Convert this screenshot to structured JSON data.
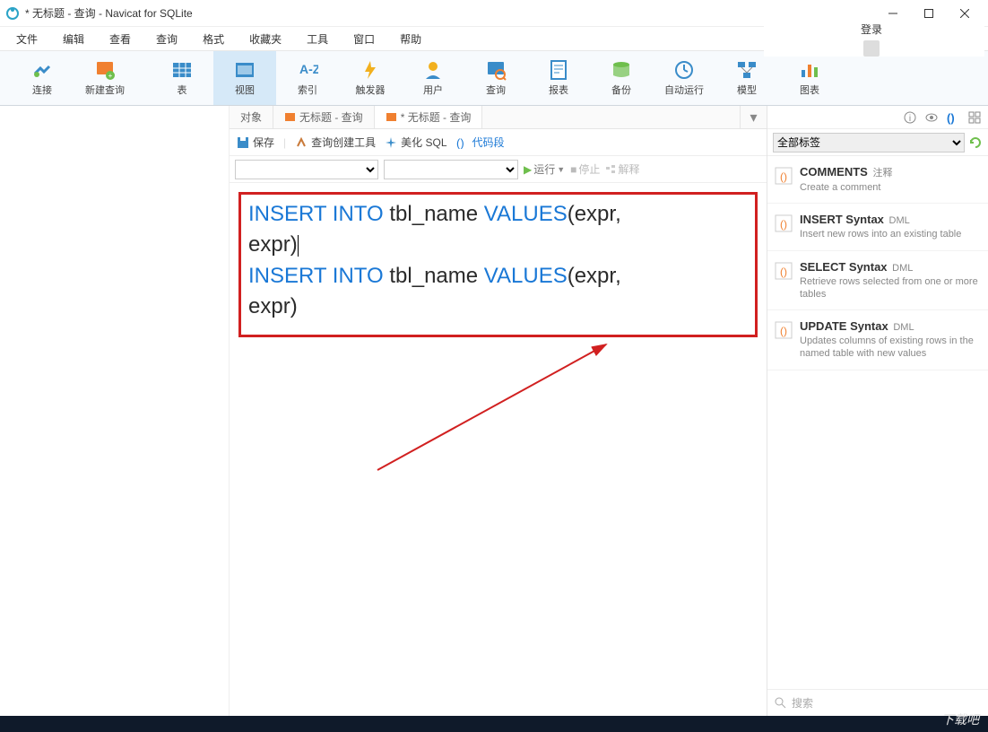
{
  "window": {
    "title": "* 无标题 - 查询 - Navicat for SQLite"
  },
  "menu": {
    "file": "文件",
    "edit": "编辑",
    "view": "查看",
    "query": "查询",
    "format": "格式",
    "favorites": "收藏夹",
    "tools": "工具",
    "window": "窗口",
    "help": "帮助",
    "login": "登录"
  },
  "toolbar": {
    "connect": "连接",
    "newquery": "新建查询",
    "table": "表",
    "view": "视图",
    "index": "索引",
    "trigger": "触发器",
    "user": "用户",
    "query": "查询",
    "report": "报表",
    "backup": "备份",
    "auto": "自动运行",
    "model": "模型",
    "chart": "图表"
  },
  "tabs": {
    "objects": "对象",
    "untitled1": "无标题 - 查询",
    "untitled2": "* 无标题 - 查询"
  },
  "subtoolbar": {
    "save": "保存",
    "builder": "查询创建工具",
    "beautify": "美化 SQL",
    "snippet": "代码段"
  },
  "runbar": {
    "run": "运行",
    "stop": "停止",
    "explain": "解释"
  },
  "code": {
    "l1a": "INSERT INTO",
    "l1b": " tbl_name ",
    "l1c": "VALUES",
    "l1d": "(expr,",
    "l2a": "expr)",
    "l3a": "INSERT INTO",
    "l3b": " tbl_name ",
    "l3c": "VALUES",
    "l3d": "(expr,",
    "l4a": "expr)"
  },
  "sidebar": {
    "alltags": "全部标签",
    "items": [
      {
        "title": "COMMENTS",
        "tag": "注释",
        "desc": "Create a comment"
      },
      {
        "title": "INSERT Syntax",
        "tag": "DML",
        "desc": "Insert new rows into an existing table"
      },
      {
        "title": "SELECT Syntax",
        "tag": "DML",
        "desc": "Retrieve rows selected from one or more tables"
      },
      {
        "title": "UPDATE Syntax",
        "tag": "DML",
        "desc": "Updates columns of existing rows in the named table with new values"
      }
    ],
    "search": "搜索"
  },
  "watermark": "下载吧"
}
